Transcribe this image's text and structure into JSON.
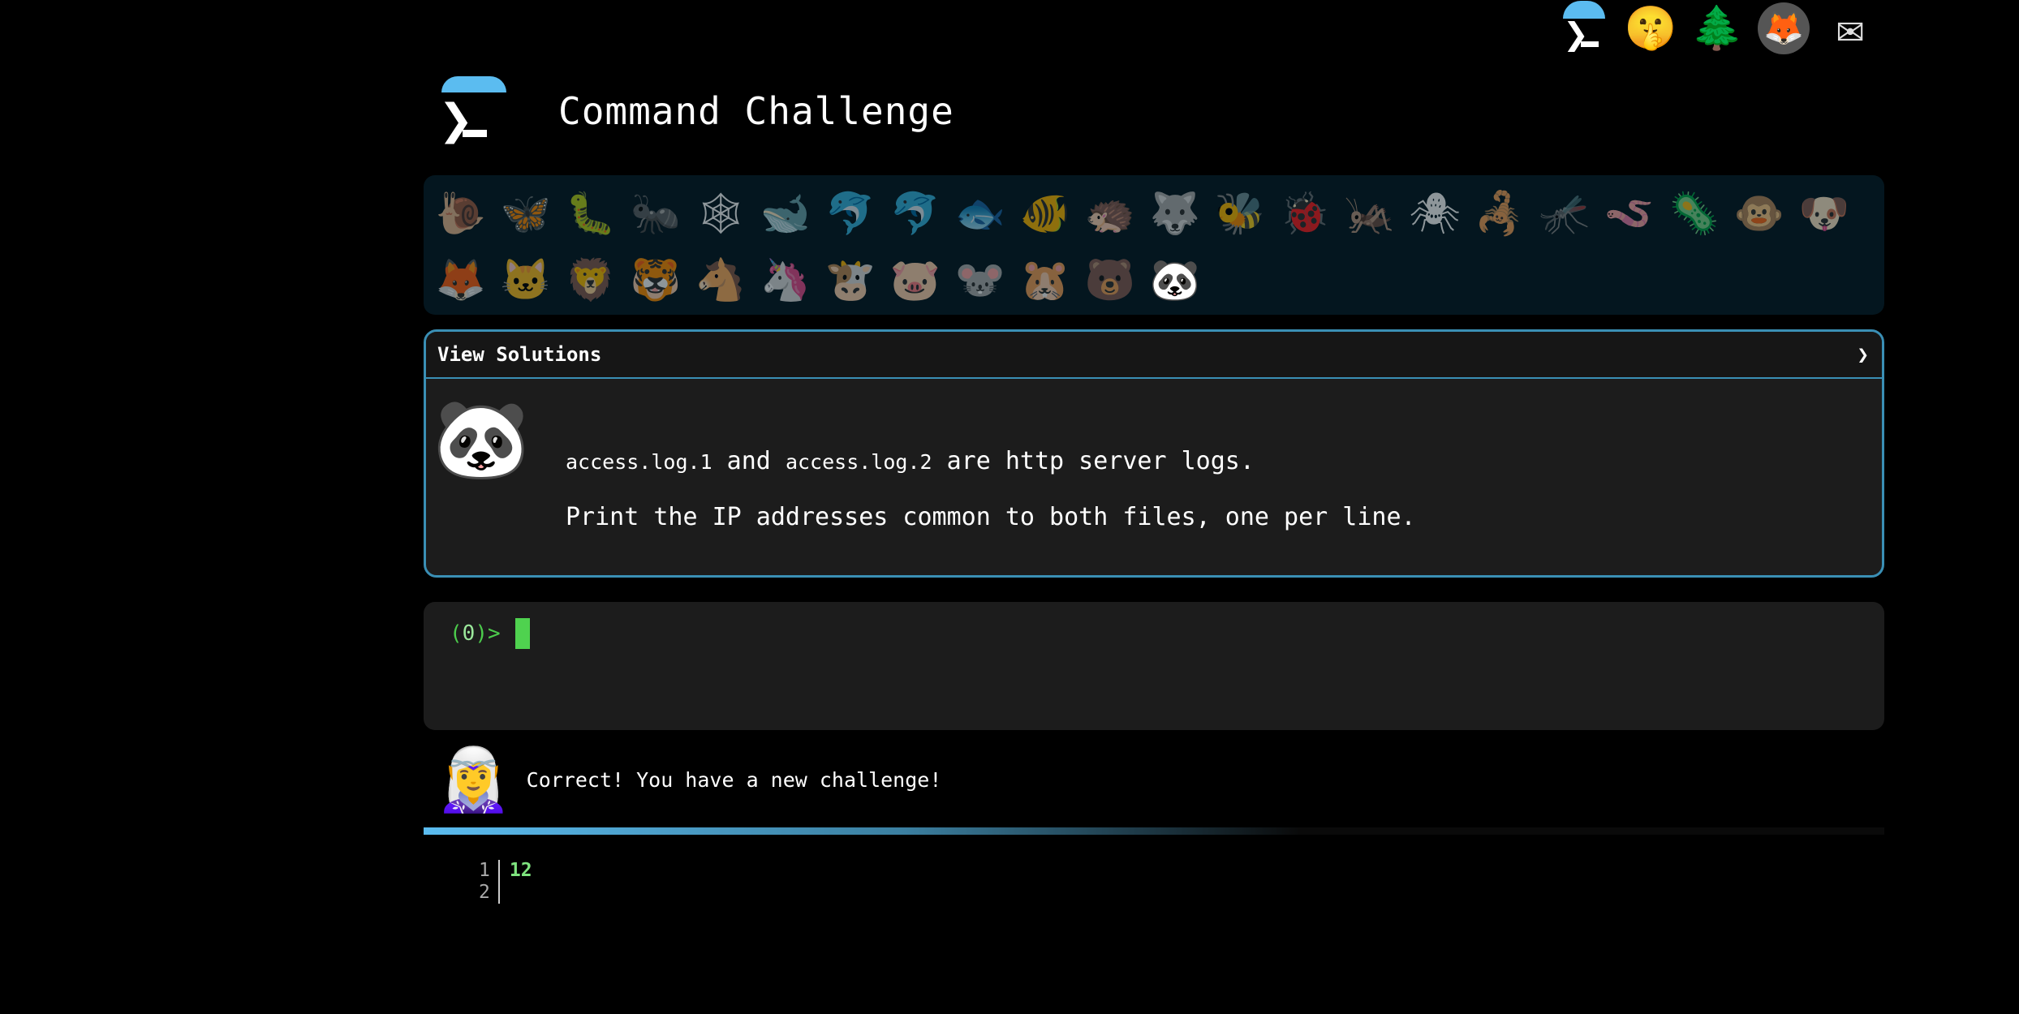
{
  "top_nav": [
    {
      "icon": "terminal-prompt-icon"
    },
    {
      "icon": "shushing-face-icon",
      "glyph": "🤫"
    },
    {
      "icon": "tree-icon",
      "glyph": "🌲"
    },
    {
      "icon": "gitlab-icon",
      "glyph": "🦊"
    },
    {
      "icon": "envelope-icon",
      "glyph": "✉"
    }
  ],
  "header": {
    "title": "Command Challenge"
  },
  "animals": [
    "🐌",
    "🦋",
    "🐛",
    "🐜",
    "🕸",
    "🐋",
    "🐬",
    "🐬",
    "🐟",
    "🐠",
    "🦔",
    "🐺",
    "🐝",
    "🐞",
    "🦗",
    "🕷",
    "🦂",
    "🦟",
    "🪱",
    "🦠",
    "🐵",
    "🐶",
    "🦊",
    "🐱",
    "🦁",
    "🐯",
    "🐴",
    "🦄",
    "🐮",
    "🐷",
    "🐭",
    "🐹",
    "🐻",
    "🐼"
  ],
  "active_animal_index": 33,
  "solutions": {
    "label": "View Solutions",
    "toggle": "❯",
    "avatar": "🐼",
    "file1": "access.log.1",
    "and": " and ",
    "file2": "access.log.2",
    "line1_rest": " are http server logs.",
    "line2": "Print the IP addresses common to both files, one per line."
  },
  "terminal": {
    "prompt_open": "(",
    "prompt_num": "0",
    "prompt_close": ")>"
  },
  "feedback": {
    "avatar": "🧝‍♀️",
    "message": "Correct! You have a new challenge!"
  },
  "progress": {
    "fraction": 0.6
  },
  "output": {
    "line_numbers": [
      "1",
      "2"
    ],
    "lines": [
      "12",
      ""
    ]
  }
}
